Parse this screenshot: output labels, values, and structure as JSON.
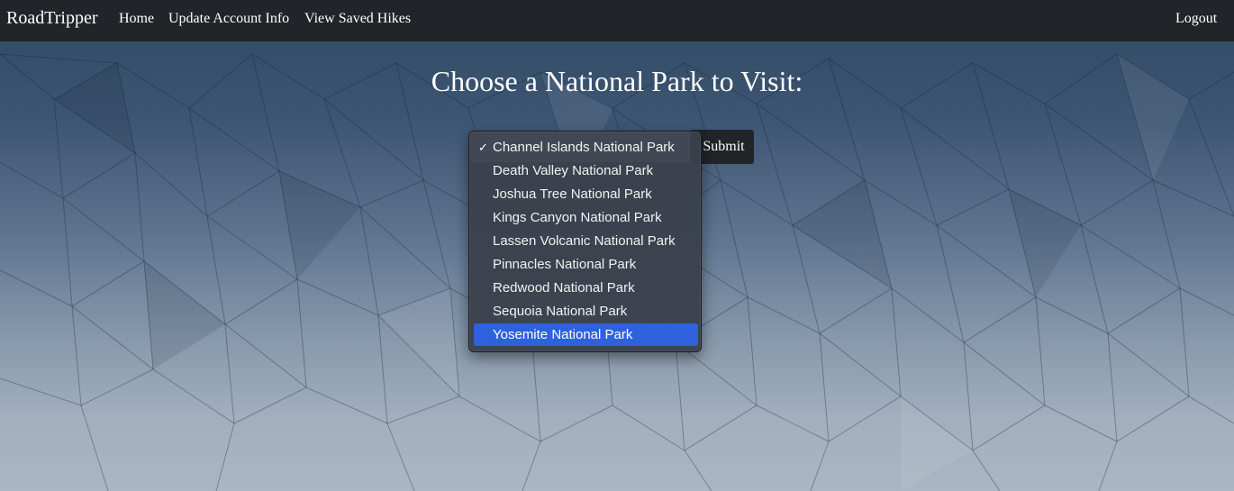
{
  "navbar": {
    "brand": "RoadTripper",
    "links": {
      "home": "Home",
      "update_account": "Update Account Info",
      "saved_hikes": "View Saved Hikes",
      "logout": "Logout"
    }
  },
  "main": {
    "heading": "Choose a National Park to Visit:",
    "submit_label": "Submit",
    "park_select": {
      "selected": "Channel Islands National Park",
      "highlighted": "Yosemite National Park",
      "checkmark": "✓",
      "options": [
        "Channel Islands National Park",
        "Death Valley National Park",
        "Joshua Tree National Park",
        "Kings Canyon National Park",
        "Lassen Volcanic National Park",
        "Pinnacles National Park",
        "Redwood National Park",
        "Sequoia National Park",
        "Yosemite National Park"
      ]
    }
  },
  "colors": {
    "navbar_bg": "#212529",
    "highlight": "#2d62dc",
    "bg_top": "#2f4862",
    "bg_bottom": "#aab6c3"
  }
}
